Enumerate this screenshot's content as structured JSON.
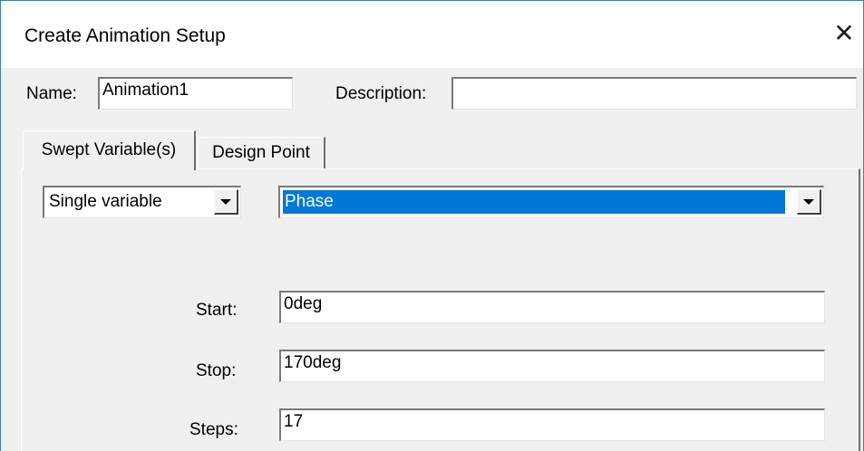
{
  "window": {
    "title": "Create Animation Setup",
    "close_glyph": "✕"
  },
  "form": {
    "name_label": "Name:",
    "name_value": "Animation1",
    "description_label": "Description:",
    "description_value": ""
  },
  "tabs": [
    {
      "label": "Swept Variable(s)",
      "active": true
    },
    {
      "label": "Design Point",
      "active": false
    }
  ],
  "sweep": {
    "mode_value": "Single variable",
    "variable_value": "Phase",
    "start_label": "Start:",
    "start_value": "0deg",
    "stop_label": "Stop:",
    "stop_value": "170deg",
    "steps_label": "Steps:",
    "steps_value": "17"
  },
  "colors": {
    "selection": "#0078d7",
    "window_border": "#3c7fb1"
  }
}
